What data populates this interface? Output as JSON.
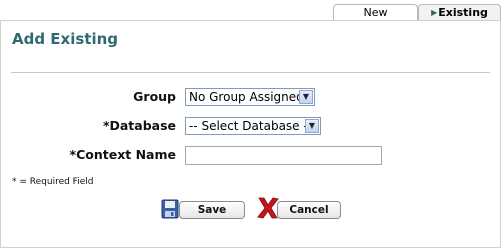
{
  "tabs": [
    {
      "label": "New",
      "active": false
    },
    {
      "label": "Existing",
      "active": true
    }
  ],
  "page": {
    "title": "Add Existing"
  },
  "form": {
    "group": {
      "label": "Group",
      "value": "No Group Assigned"
    },
    "database": {
      "label": "*Database",
      "value": "-- Select Database --"
    },
    "context_name": {
      "label": "*Context Name",
      "value": ""
    },
    "required_note": "* = Required Field"
  },
  "buttons": {
    "save_label": "Save",
    "cancel_label": "Cancel"
  },
  "icons": {
    "save": "floppy-disk-icon",
    "cancel": "red-x-icon",
    "dropdown": "chevron-down-icon",
    "tab_arrow": "triangle-right-icon"
  },
  "colors": {
    "title": "#2e6b70",
    "cancel_icon": "#c8151b",
    "save_icon": "#3b5fa8"
  }
}
